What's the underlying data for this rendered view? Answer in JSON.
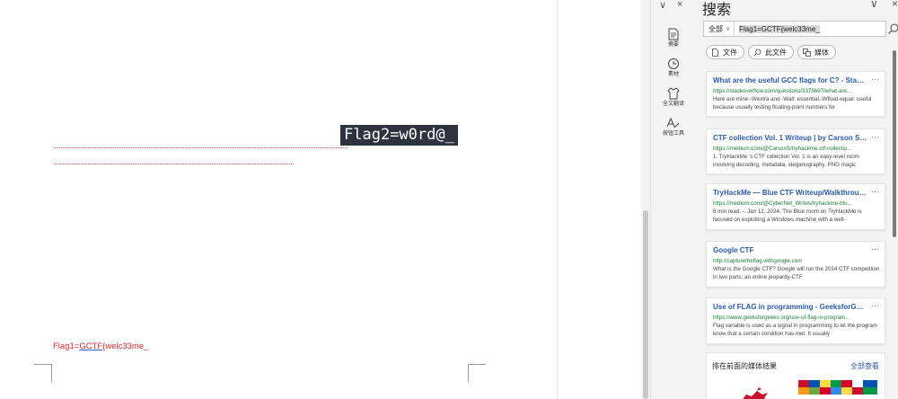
{
  "document": {
    "flag2_text": "Flag2=w0rd@_",
    "flag1_prefix": "Flag1=",
    "flag1_underlined": "GCTF",
    "flag1_suffix": "{welc33me_"
  },
  "rail": {
    "top_controls": [
      "∨",
      "×"
    ],
    "items": [
      {
        "icon": "document-icon",
        "label": "摘要"
      },
      {
        "icon": "clock-icon",
        "label": "素材"
      },
      {
        "icon": "shirt-icon",
        "label": "全文翻译"
      },
      {
        "icon": "pen-ai-icon",
        "label": "按钮工具"
      }
    ]
  },
  "search": {
    "title": "搜索",
    "controls": [
      "∨",
      "×"
    ],
    "scope": "全部",
    "query": "Flag1=GCTF{welc33me_",
    "chips": [
      {
        "icon": "file-icon",
        "label": "文件"
      },
      {
        "icon": "search-icon",
        "label": "此文件"
      },
      {
        "icon": "media-icon",
        "label": "媒体"
      }
    ],
    "results": [
      {
        "title": "What are the useful GCC flags for C? - Stack ...",
        "url": "https://stackoverflow.com/questions/3375697/what-are...",
        "snippet": "Here are mine:-Wextra and -Wall: essential.-Wfloat-equal: useful because usually testing floating-point numbers for"
      },
      {
        "title": "CTF collection Vol. 1 Writeup | by Carson Sha...",
        "url": "https://medium.com/@CarsonS/tryhackme-ctf-collectio...",
        "snippet": "1. TryHackMe 's CTF collection Vol. 1 is an easy-level room involving decoding, metadata, steganography, PNG magic"
      },
      {
        "title": "TryHackMe — Blue CTF Writeup/Walkthroug...",
        "url": "https://medium.com/@CyberNet_Writes/tryhackme-blu...",
        "snippet": "8 min read. -. Jan 12, 2024. The Blue room on TryHackMe is focused on exploiting a Windows machine with a well-"
      },
      {
        "title": "Google CTF",
        "url": "http://capturetheflag.withgoogle.com",
        "snippet": "What is the Google CTF? Google will run the 2024 CTF competition in two parts: an online jeopardy-CTF"
      },
      {
        "title": "Use of FLAG in programming - GeeksforGeeks",
        "url": "https://www.geeksforgeeks.org/use-of-flag-in-program...",
        "snippet": "Flag variable is used as a signal in programming to let the program know that a certain condition has met. It usually"
      }
    ],
    "media_section": {
      "title": "排在前面的媒体结果",
      "see_all": "全部查看"
    },
    "more_glyph": "···"
  },
  "colors": {
    "link": "#2b5aa8",
    "url": "#1a7f37",
    "flag1": "#d42a2a",
    "flag2_bg": "#2d3440"
  }
}
